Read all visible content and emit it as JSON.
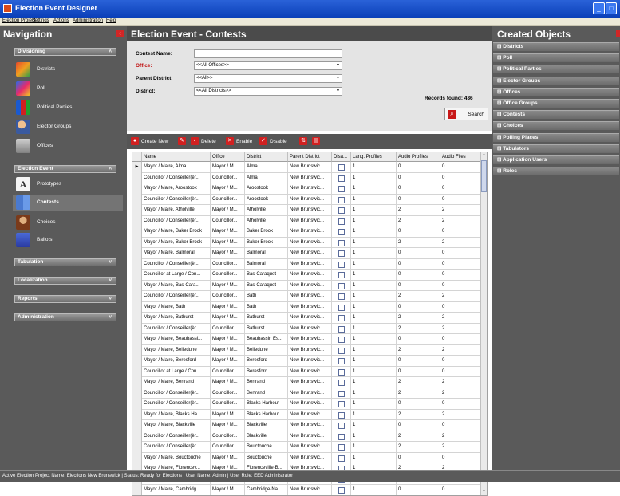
{
  "window": {
    "title": "Election Event Designer"
  },
  "menu": [
    "Election Project",
    "Settings",
    "Actions",
    "Administration",
    "Help"
  ],
  "nav": {
    "title": "Navigation",
    "groups": [
      {
        "label": "Divisioning",
        "items": [
          "Districts",
          "Poll",
          "Political Parties",
          "Elector Groups",
          "Offices"
        ]
      },
      {
        "label": "Election Event",
        "items": [
          "Prototypes",
          "Contests",
          "Choices",
          "Ballots"
        ]
      },
      {
        "label": "Tabulation"
      },
      {
        "label": "Localization"
      },
      {
        "label": "Reports"
      },
      {
        "label": "Administration"
      }
    ]
  },
  "main": {
    "title": "Election Event - Contests",
    "filter": {
      "contest_name_label": "Contest Name:",
      "contest_name_value": "",
      "office_label": "Office:",
      "office_value": "<<All Offices>>",
      "parent_district_label": "Parent District:",
      "parent_district_value": "<<All>>",
      "district_label": "District:",
      "district_value": "<<All Districts>>",
      "records_found": "Records found: 436",
      "search_label": "Search"
    },
    "toolbar": {
      "create_new": "Create New",
      "delete": "Delete",
      "enable": "Enable",
      "disable": "Disable"
    },
    "columns": [
      "Name",
      "Office",
      "District",
      "Parent District",
      "Disa...",
      "Lang. Profiles",
      "Audio Profiles",
      "Audio Files"
    ],
    "rows": [
      [
        "Mayor / Maire, Alma",
        "Mayor / M...",
        "Alma",
        "New Brunswic...",
        "1",
        "0",
        "0"
      ],
      [
        "Councillor / Conseiller(èr...",
        "Councillor...",
        "Alma",
        "New Brunswic...",
        "1",
        "0",
        "0"
      ],
      [
        "Mayor / Maire, Aroostook",
        "Mayor / M...",
        "Aroostook",
        "New Brunswic...",
        "1",
        "0",
        "0"
      ],
      [
        "Councillor / Conseiller(èr...",
        "Councillor...",
        "Aroostook",
        "New Brunswic...",
        "1",
        "0",
        "0"
      ],
      [
        "Mayor / Maire, Atholville",
        "Mayor / M...",
        "Atholville",
        "New Brunswic...",
        "1",
        "2",
        "2"
      ],
      [
        "Councillor / Conseiller(èr...",
        "Councillor...",
        "Atholville",
        "New Brunswic...",
        "1",
        "2",
        "2"
      ],
      [
        "Mayor / Maire, Baker Brook",
        "Mayor / M...",
        "Baker Brook",
        "New Brunswic...",
        "1",
        "0",
        "0"
      ],
      [
        "Mayor / Maire, Baker Brook",
        "Mayor / M...",
        "Baker Brook",
        "New Brunswic...",
        "1",
        "2",
        "2"
      ],
      [
        "Mayor / Maire, Balmoral",
        "Mayor / M...",
        "Balmoral",
        "New Brunswic...",
        "1",
        "0",
        "0"
      ],
      [
        "Councillor / Conseiller(èr...",
        "Councillor...",
        "Balmoral",
        "New Brunswic...",
        "1",
        "0",
        "0"
      ],
      [
        "Councillor at Large / Con...",
        "Councillor...",
        "Bas-Caraquet",
        "New Brunswic...",
        "1",
        "0",
        "0"
      ],
      [
        "Mayor / Maire, Bas-Cara...",
        "Mayor / M...",
        "Bas-Caraquet",
        "New Brunswic...",
        "1",
        "0",
        "0"
      ],
      [
        "Councillor / Conseiller(èr...",
        "Councillor...",
        "Bath",
        "New Brunswic...",
        "1",
        "2",
        "2"
      ],
      [
        "Mayor / Maire, Bath",
        "Mayor / M...",
        "Bath",
        "New Brunswic...",
        "1",
        "0",
        "0"
      ],
      [
        "Mayor / Maire, Bathurst",
        "Mayor / M...",
        "Bathurst",
        "New Brunswic...",
        "1",
        "2",
        "2"
      ],
      [
        "Councillor / Conseiller(èr...",
        "Councillor...",
        "Bathurst",
        "New Brunswic...",
        "1",
        "2",
        "2"
      ],
      [
        "Mayor / Maire, Beaubassi...",
        "Mayor / M...",
        "Beaubassin Es...",
        "New Brunswic...",
        "1",
        "0",
        "0"
      ],
      [
        "Mayor / Maire, Belledune",
        "Mayor / M...",
        "Belledune",
        "New Brunswic...",
        "1",
        "2",
        "2"
      ],
      [
        "Mayor / Maire, Beresford",
        "Mayor / M...",
        "Beresford",
        "New Brunswic...",
        "1",
        "0",
        "0"
      ],
      [
        "Councillor at Large / Con...",
        "Councillor...",
        "Beresford",
        "New Brunswic...",
        "1",
        "0",
        "0"
      ],
      [
        "Mayor / Maire, Bertrand",
        "Mayor / M...",
        "Bertrand",
        "New Brunswic...",
        "1",
        "2",
        "2"
      ],
      [
        "Councillor / Conseiller(èr...",
        "Councillor...",
        "Bertrand",
        "New Brunswic...",
        "1",
        "2",
        "2"
      ],
      [
        "Councillor / Conseiller(èr...",
        "Councillor...",
        "Blacks Harbour",
        "New Brunswic...",
        "1",
        "0",
        "0"
      ],
      [
        "Mayor / Maire, Blacks Ha...",
        "Mayor / M...",
        "Blacks Harbour",
        "New Brunswic...",
        "1",
        "2",
        "2"
      ],
      [
        "Mayor / Maire, Blackville",
        "Mayor / M...",
        "Blackville",
        "New Brunswic...",
        "1",
        "0",
        "0"
      ],
      [
        "Councillor / Conseiller(èr...",
        "Councillor...",
        "Blackville",
        "New Brunswic...",
        "1",
        "2",
        "2"
      ],
      [
        "Councillor / Conseiller(èr...",
        "Councillor...",
        "Bouctouche",
        "New Brunswic...",
        "1",
        "2",
        "2"
      ],
      [
        "Mayor / Maire, Bouctouche",
        "Mayor / M...",
        "Bouctouche",
        "New Brunswic...",
        "1",
        "0",
        "0"
      ],
      [
        "Mayor / Maire, Florencev...",
        "Mayor / M...",
        "Florenceville-B...",
        "New Brunswic...",
        "1",
        "2",
        "2"
      ],
      [
        "Councillor / Conseiller(èr...",
        "Councillor...",
        "Cambridge-Na...",
        "New Brunswic...",
        "1",
        "0",
        "0"
      ],
      [
        "Mayor / Maire, Cambridg...",
        "Mayor / M...",
        "Cambridge-Na...",
        "New Brunswic...",
        "1",
        "0",
        "0"
      ]
    ]
  },
  "created": {
    "title": "Created Objects",
    "items": [
      "Districts",
      "Poll",
      "Political Parties",
      "Elector Groups",
      "Offices",
      "Office Groups",
      "Contests",
      "Choices",
      "Polling Places",
      "Tabulators",
      "Application Users",
      "Roles"
    ]
  },
  "status": "Active Election Project Name: Elections New Brunswick | Status: Ready for Elections | User Name: Admin | User Role: EED Administrator",
  "colors": {
    "accent": "#d12626",
    "panel": "#5a5a5a",
    "titlebar": "#0a3fb8"
  }
}
